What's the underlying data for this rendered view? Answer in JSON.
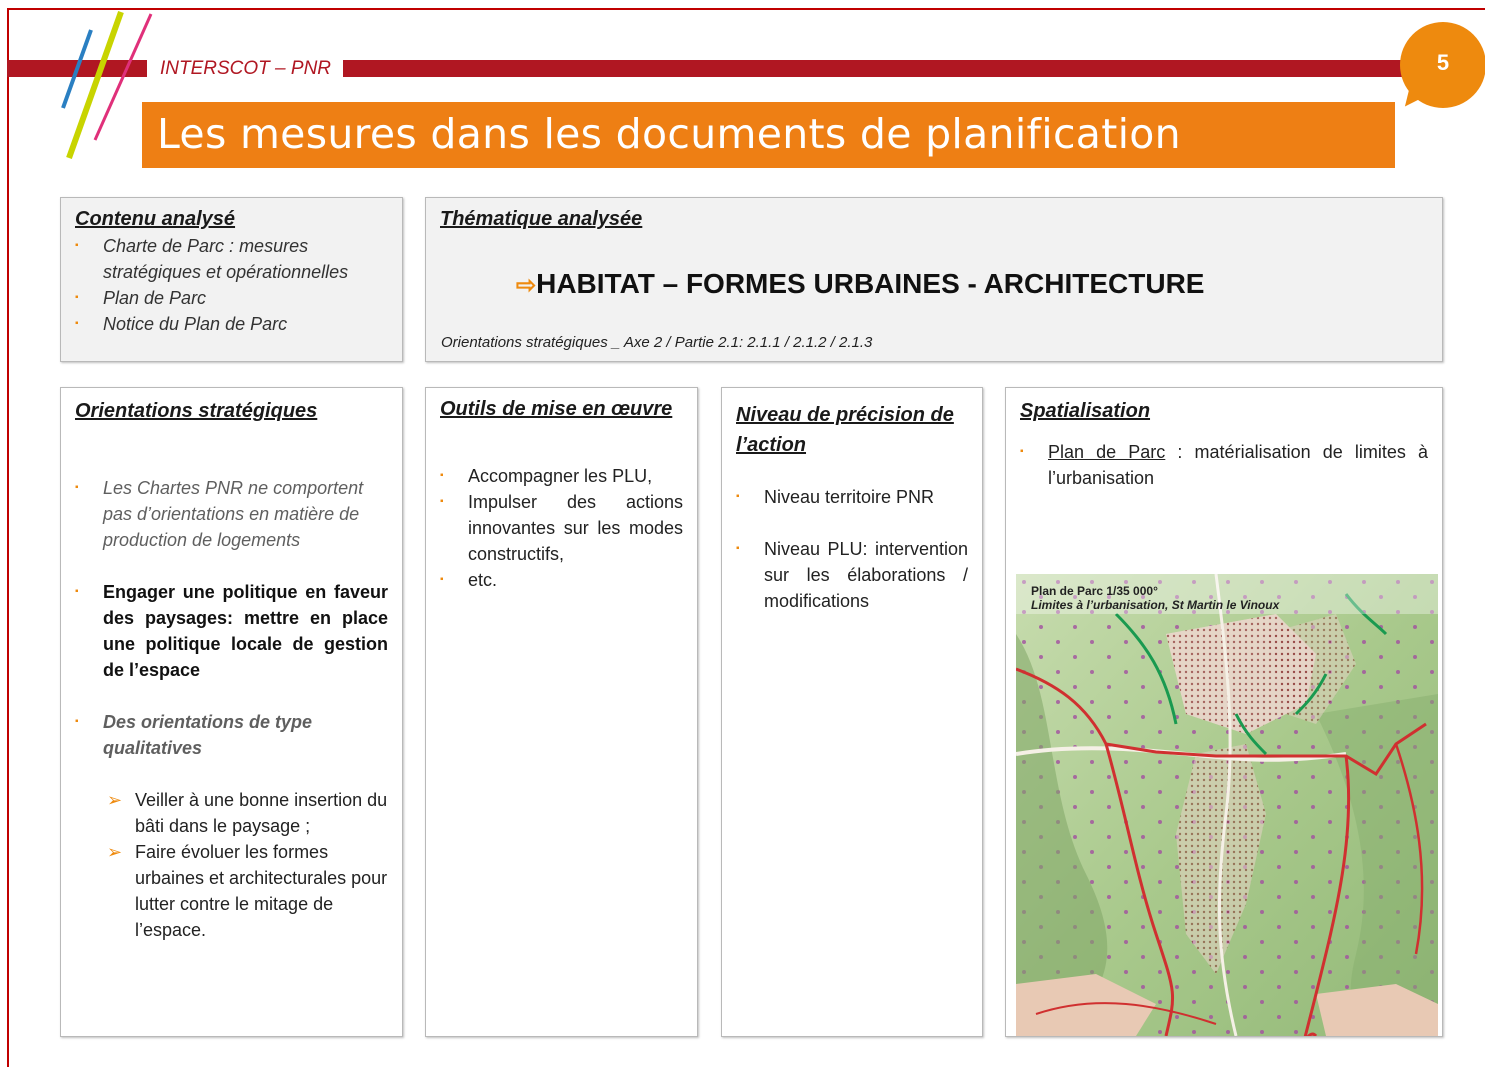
{
  "header": {
    "brand": "INTERSCOT – PNR",
    "title": "Les mesures dans les documents de planification",
    "page_number": "5"
  },
  "contenu": {
    "heading": "Contenu analysé",
    "items": [
      "Charte de Parc : mesures stratégiques et opérationnelles",
      "Plan de Parc",
      "Notice du Plan de Parc"
    ]
  },
  "thematique": {
    "heading": "Thématique analysée",
    "theme": "HABITAT – FORMES URBAINES - ARCHITECTURE",
    "orientations": "Orientations stratégiques _ Axe 2 / Partie 2.1: 2.1.1 / 2.1.2 / 2.1.3"
  },
  "orientations": {
    "heading": "Orientations stratégiques",
    "item1": "Les Chartes PNR ne comportent pas d’orientations en matière de production de logements",
    "item2": "Engager une politique en faveur des paysages: mettre en place une politique locale de gestion de l’espace",
    "item3": "Des orientations de type qualitatives",
    "sub_items": [
      "Veiller à une bonne insertion du bâti dans le paysage ;",
      "Faire évoluer les formes urbaines et architecturales pour lutter contre le mitage de l’espace."
    ]
  },
  "outils": {
    "heading": "Outils de mise en œuvre",
    "items": [
      "Accompagner les PLU,",
      "Impulser des actions innovantes sur les modes constructifs,",
      "etc."
    ]
  },
  "niveau": {
    "heading": "Niveau de précision de l’action",
    "items": [
      "Niveau territoire PNR",
      "Niveau PLU: intervention sur les élaborations / modifications"
    ]
  },
  "spatialisation": {
    "heading": "Spatialisation",
    "item_link": "Plan de Parc",
    "item_rest": " : matérialisation de limites à l’urbanisation",
    "map_caption1": "Plan de Parc 1/35 000°",
    "map_caption2": "Limites à l’urbanisation, St Martin le Vinoux"
  },
  "colors": {
    "accent_orange": "#ee7f14",
    "brand_red": "#b01722",
    "map_green": "#a9c98c",
    "map_boundary": "#d03030"
  }
}
